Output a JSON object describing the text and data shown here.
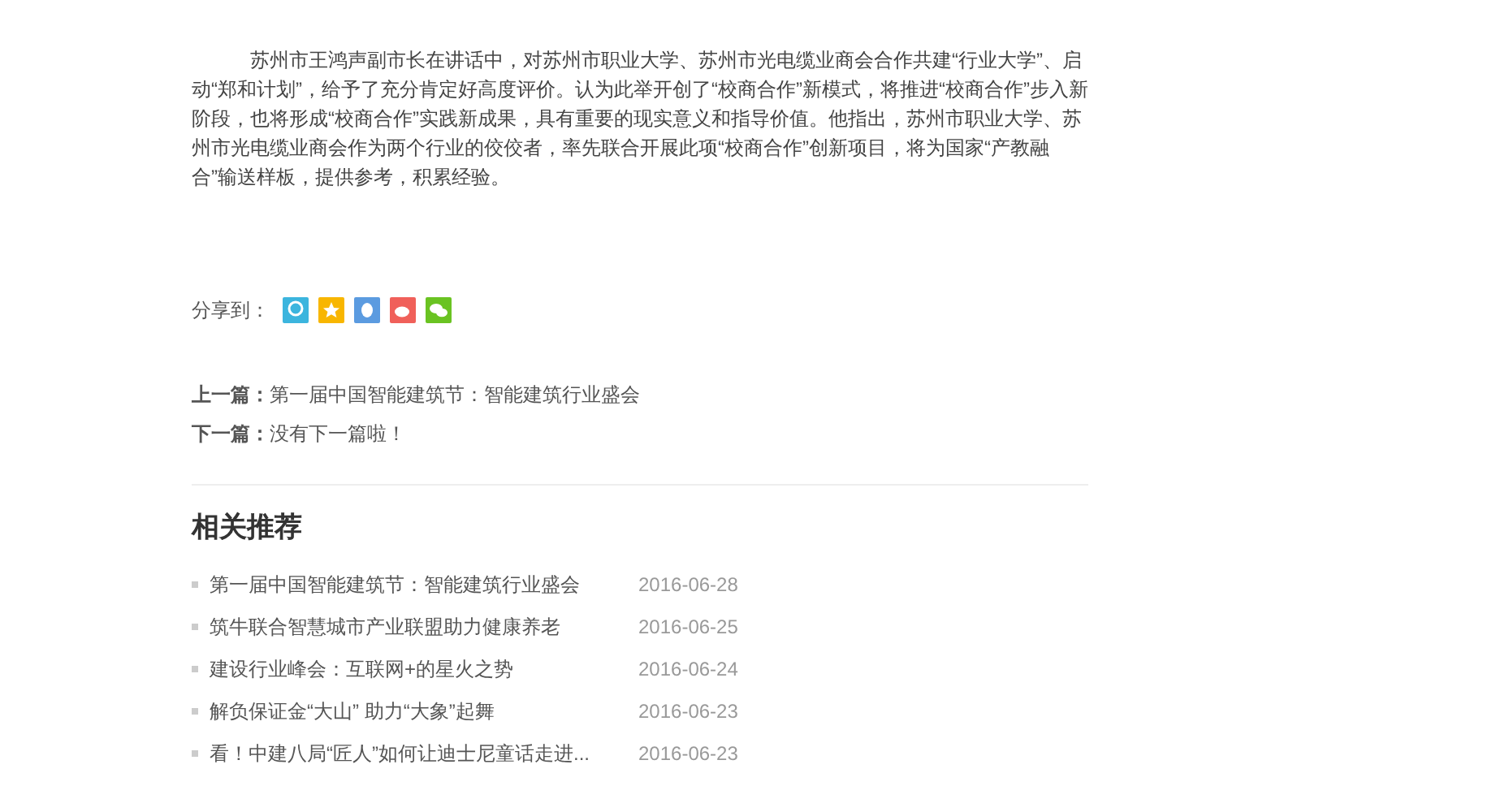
{
  "article": {
    "paragraph": "苏州市王鸿声副市长在讲话中，对苏州市职业大学、苏州市光电缆业商会合作共建“行业大学”、启动“郑和计划”，给予了充分肯定好高度评价。认为此举开创了“校商合作”新模式，将推进“校商合作”步入新阶段，也将形成“校商合作”实践新成果，具有重要的现实意义和指导价值。他指出，苏州市职业大学、苏州市光电缆业商会作为两个行业的佼佼者，率先联合开展此项“校商合作”创新项目，将为国家“产教融合”输送样板，提供参考，积累经验。"
  },
  "share": {
    "label": "分享到：",
    "icons": [
      {
        "kind": "qzone",
        "color": "#3cb5de"
      },
      {
        "kind": "star",
        "color": "#f8b600"
      },
      {
        "kind": "qq",
        "color": "#5b9be0"
      },
      {
        "kind": "weibo",
        "color": "#f0605a"
      },
      {
        "kind": "wechat",
        "color": "#6ac322"
      }
    ]
  },
  "nav": [
    {
      "label": "上一篇：",
      "title": "第一届中国智能建筑节：智能建筑行业盛会"
    },
    {
      "label": "下一篇：",
      "title": "没有下一篇啦！"
    }
  ],
  "related": {
    "heading": "相关推荐",
    "items": [
      {
        "title": "第一届中国智能建筑节：智能建筑行业盛会",
        "date": "2016-06-28"
      },
      {
        "title": "筑牛联合智慧城市产业联盟助力健康养老",
        "date": "2016-06-25"
      },
      {
        "title": "建设行业峰会：互联网+的星火之势",
        "date": "2016-06-24"
      },
      {
        "title": "解负保证金“大山” 助力“大象”起舞",
        "date": "2016-06-23"
      },
      {
        "title": "看！中建八局“匠人”如何让迪士尼童话走进...",
        "date": "2016-06-23"
      }
    ]
  }
}
